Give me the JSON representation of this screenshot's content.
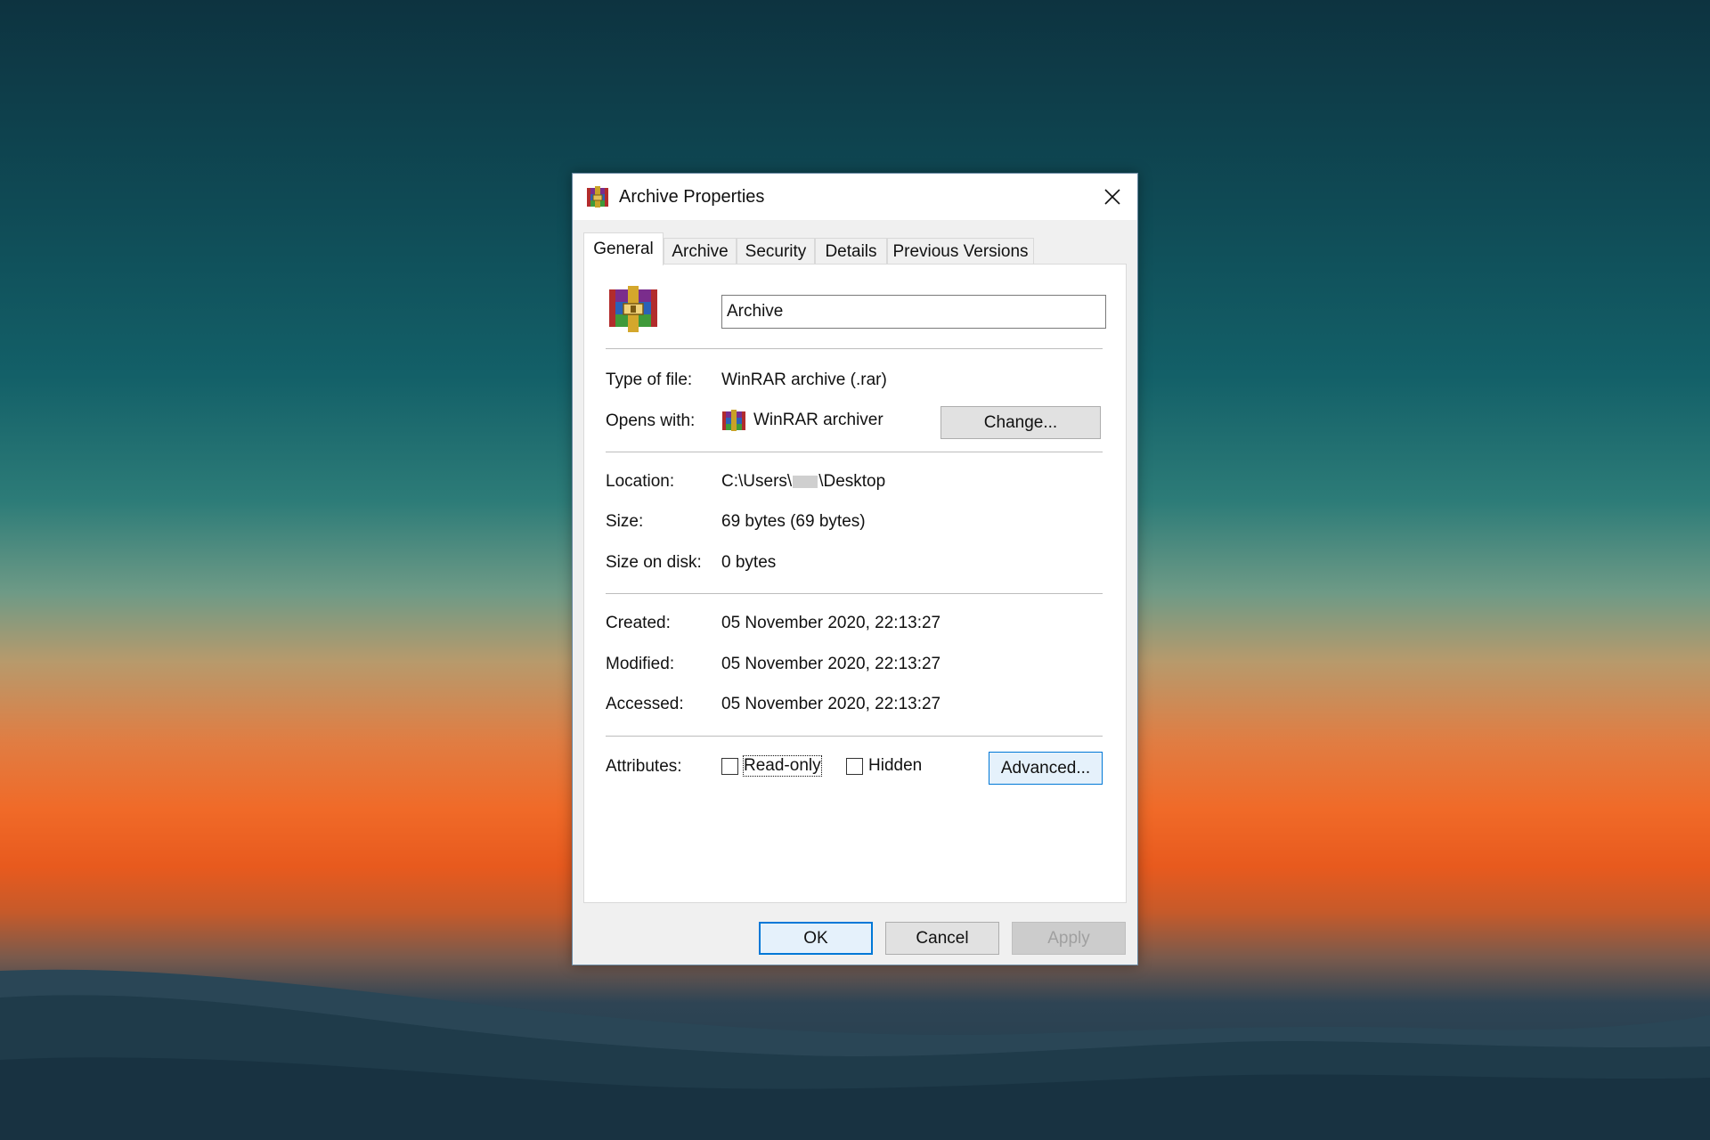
{
  "dialog": {
    "title": "Archive Properties",
    "close_icon": "close-icon",
    "app_icon": "winrar-icon"
  },
  "tabs": [
    {
      "label": "General",
      "active": true
    },
    {
      "label": "Archive",
      "active": false
    },
    {
      "label": "Security",
      "active": false
    },
    {
      "label": "Details",
      "active": false
    },
    {
      "label": "Previous Versions",
      "active": false
    }
  ],
  "general": {
    "file_name": "Archive",
    "type_label": "Type of file:",
    "type_value": "WinRAR archive (.rar)",
    "opens_label": "Opens with:",
    "opens_value": "WinRAR archiver",
    "change_button": "Change...",
    "location_label": "Location:",
    "location_prefix": "C:\\Users\\",
    "location_suffix": "\\Desktop",
    "size_label": "Size:",
    "size_value": "69 bytes (69 bytes)",
    "size_disk_label": "Size on disk:",
    "size_disk_value": "0 bytes",
    "created_label": "Created:",
    "created_value": "05 November 2020, 22:13:27",
    "modified_label": "Modified:",
    "modified_value": "05 November 2020, 22:13:27",
    "accessed_label": "Accessed:",
    "accessed_value": "05 November 2020, 22:13:27",
    "attributes_label": "Attributes:",
    "readonly_label": "Read-only",
    "readonly_checked": false,
    "hidden_label": "Hidden",
    "hidden_checked": false,
    "advanced_button": "Advanced..."
  },
  "footer": {
    "ok": "OK",
    "cancel": "Cancel",
    "apply": "Apply"
  },
  "colors": {
    "focus_blue": "#0078d7",
    "dialog_bg": "#f0f0f0"
  }
}
